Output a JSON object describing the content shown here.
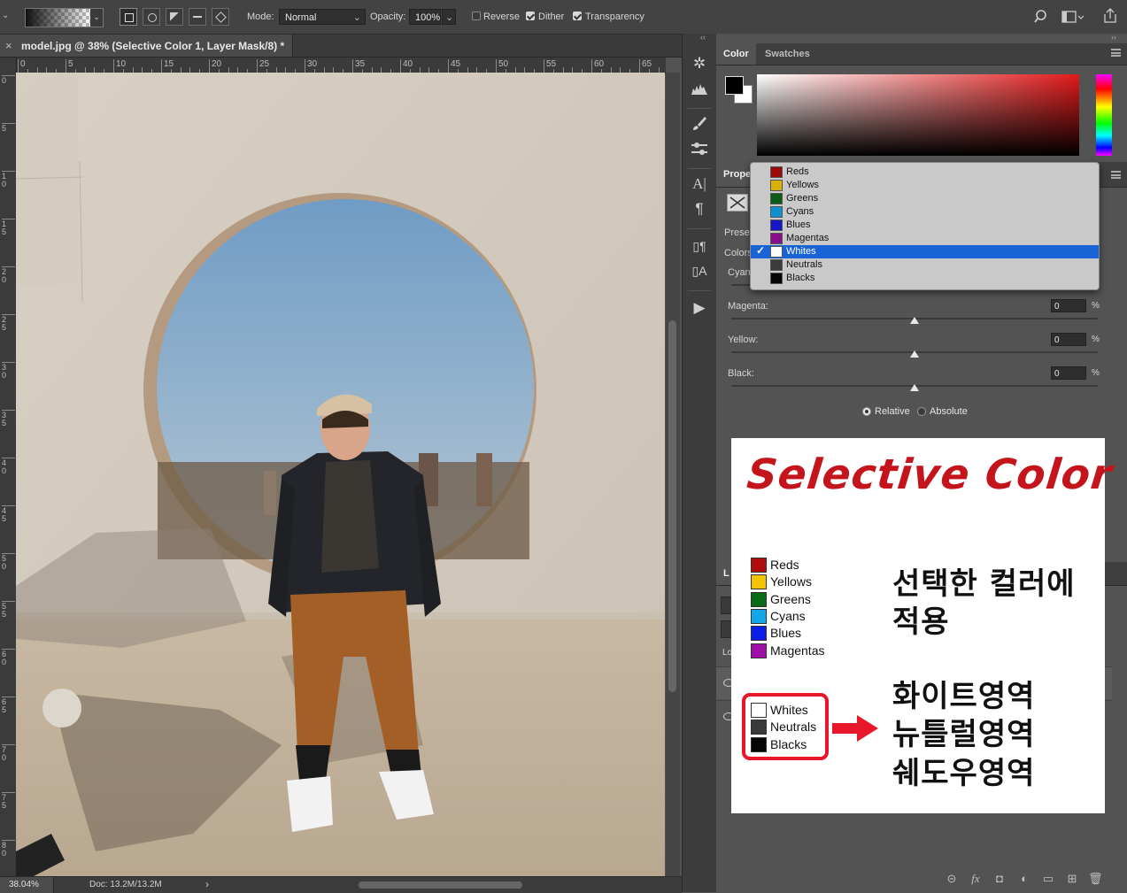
{
  "options_bar": {
    "mode_label": "Mode:",
    "mode_value": "Normal",
    "opacity_label": "Opacity:",
    "opacity_value": "100%",
    "reverse_label": "Reverse",
    "dither_label": "Dither",
    "transparency_label": "Transparency",
    "reverse_checked": false,
    "dither_checked": true,
    "transparency_checked": true
  },
  "document": {
    "tab_title": "model.jpg @ 38% (Selective Color 1, Layer Mask/8) *",
    "close_glyph": "×"
  },
  "rulers": {
    "horizontal": [
      "0",
      "5",
      "10",
      "15",
      "20",
      "25",
      "30",
      "35",
      "40",
      "45",
      "50",
      "55",
      "60",
      "65"
    ],
    "vertical": [
      "0",
      "5",
      "10",
      "15",
      "20",
      "25",
      "30",
      "35",
      "40",
      "45",
      "50",
      "55",
      "60",
      "65",
      "70",
      "75",
      "80"
    ]
  },
  "status_bar": {
    "zoom": "38.04%",
    "doc_size": "Doc: 13.2M/13.2M",
    "arrow": "›"
  },
  "color_panel": {
    "tabs": [
      "Color",
      "Swatches"
    ],
    "foreground_color": "#000000",
    "background_color": "#ffffff"
  },
  "properties_panel": {
    "tab_label": "Prope",
    "preset_label": "Preset",
    "colors_label": "Colors",
    "cyan_label": "Cyan",
    "sliders": [
      {
        "label": "Magenta:",
        "value": "0",
        "unit": "%"
      },
      {
        "label": "Yellow:",
        "value": "0",
        "unit": "%"
      },
      {
        "label": "Black:",
        "value": "0",
        "unit": "%"
      }
    ],
    "relative_label": "Relative",
    "absolute_label": "Absolute",
    "method_selected": "Relative"
  },
  "colors_dropdown": {
    "selected": "Whites",
    "items": [
      {
        "label": "Reds",
        "color": "#9b0a0a"
      },
      {
        "label": "Yellows",
        "color": "#d7b300"
      },
      {
        "label": "Greens",
        "color": "#0c5a17"
      },
      {
        "label": "Cyans",
        "color": "#0e8fcf"
      },
      {
        "label": "Blues",
        "color": "#1616c4"
      },
      {
        "label": "Magentas",
        "color": "#8a0e8a"
      },
      {
        "label": "Whites",
        "color": "#ffffff"
      },
      {
        "label": "Neutrals",
        "color": "#3b3b3b"
      },
      {
        "label": "Blacks",
        "color": "#050505"
      }
    ]
  },
  "layers_panel": {
    "tab_label": "L",
    "lock_label": "Lo"
  },
  "overlay_card": {
    "title": "Selective Color",
    "title_color": "#c4151c",
    "color_group": [
      {
        "label": "Reds",
        "color": "#b10d0d"
      },
      {
        "label": "Yellows",
        "color": "#f3c300"
      },
      {
        "label": "Greens",
        "color": "#0b6a16"
      },
      {
        "label": "Cyans",
        "color": "#14a6ea"
      },
      {
        "label": "Blues",
        "color": "#0a1ee8"
      },
      {
        "label": "Magentas",
        "color": "#a00ea8"
      }
    ],
    "tone_group": [
      {
        "label": "Whites",
        "color": "#ffffff"
      },
      {
        "label": "Neutrals",
        "color": "#3a3a3a"
      },
      {
        "label": "Blacks",
        "color": "#050505"
      }
    ],
    "caption_1_line1": "선택한 컬러에",
    "caption_1_line2": "적용",
    "caption_2_line1": "화이트영역",
    "caption_2_line2": "뉴틀럴영역",
    "caption_2_line3": "쉐도우영역",
    "highlight_color": "#e8162a"
  }
}
